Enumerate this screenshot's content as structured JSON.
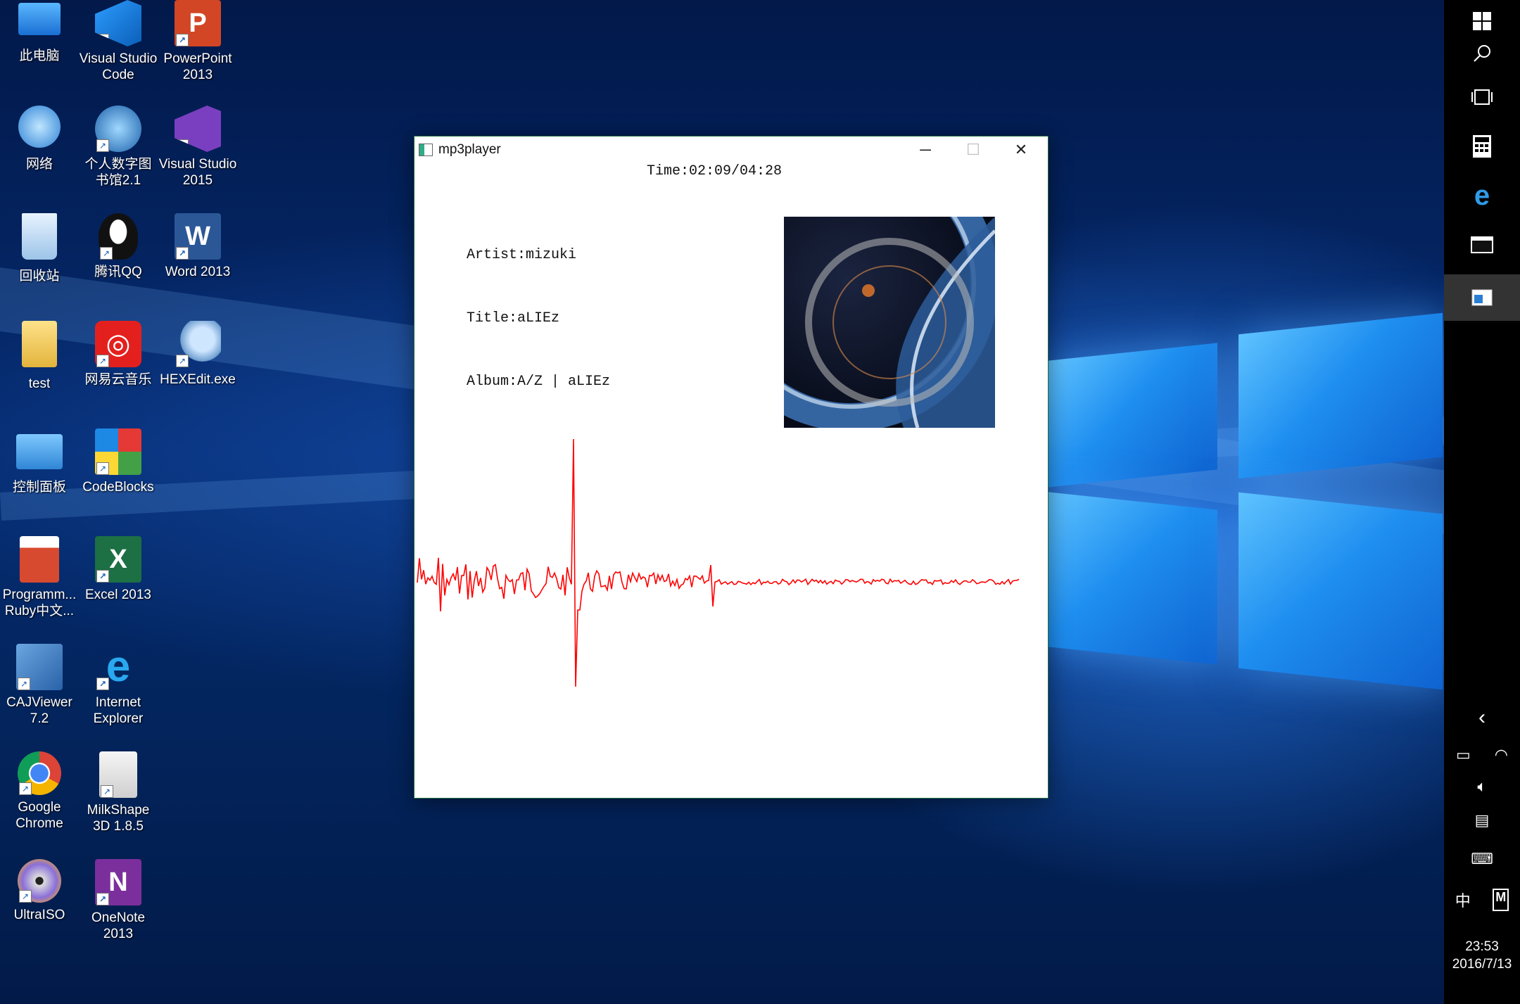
{
  "desktop": {
    "icons": [
      {
        "label": "此电脑"
      },
      {
        "label": "Visual Studio Code"
      },
      {
        "label": "PowerPoint 2013"
      },
      {
        "label": "网络"
      },
      {
        "label": "个人数字图书馆2.1"
      },
      {
        "label": "Visual Studio 2015"
      },
      {
        "label": "回收站"
      },
      {
        "label": "腾讯QQ"
      },
      {
        "label": "Word 2013"
      },
      {
        "label": "test"
      },
      {
        "label": "网易云音乐"
      },
      {
        "label": "HEXEdit.exe"
      },
      {
        "label": "控制面板"
      },
      {
        "label": "CodeBlocks"
      },
      {
        "label": "Programm... Ruby中文..."
      },
      {
        "label": "Excel 2013"
      },
      {
        "label": "CAJViewer 7.2"
      },
      {
        "label": "Internet Explorer"
      },
      {
        "label": "Google Chrome"
      },
      {
        "label": "MilkShape 3D 1.8.5"
      },
      {
        "label": "UltraISO"
      },
      {
        "label": "OneNote 2013"
      }
    ],
    "colors": {
      "accent": "#1e8ef0",
      "wave": "#ff0000"
    }
  },
  "player": {
    "window_title": "mp3player",
    "time": "Time:02:09/04:28",
    "artist": "Artist:mizuki",
    "title": "Title:aLIEz",
    "album": "Album:A/Z | aLIEz"
  },
  "sidebar": {
    "input_lang": "中",
    "ime_mode": "M",
    "clock_time": "23:53",
    "clock_date": "2016/7/13"
  }
}
